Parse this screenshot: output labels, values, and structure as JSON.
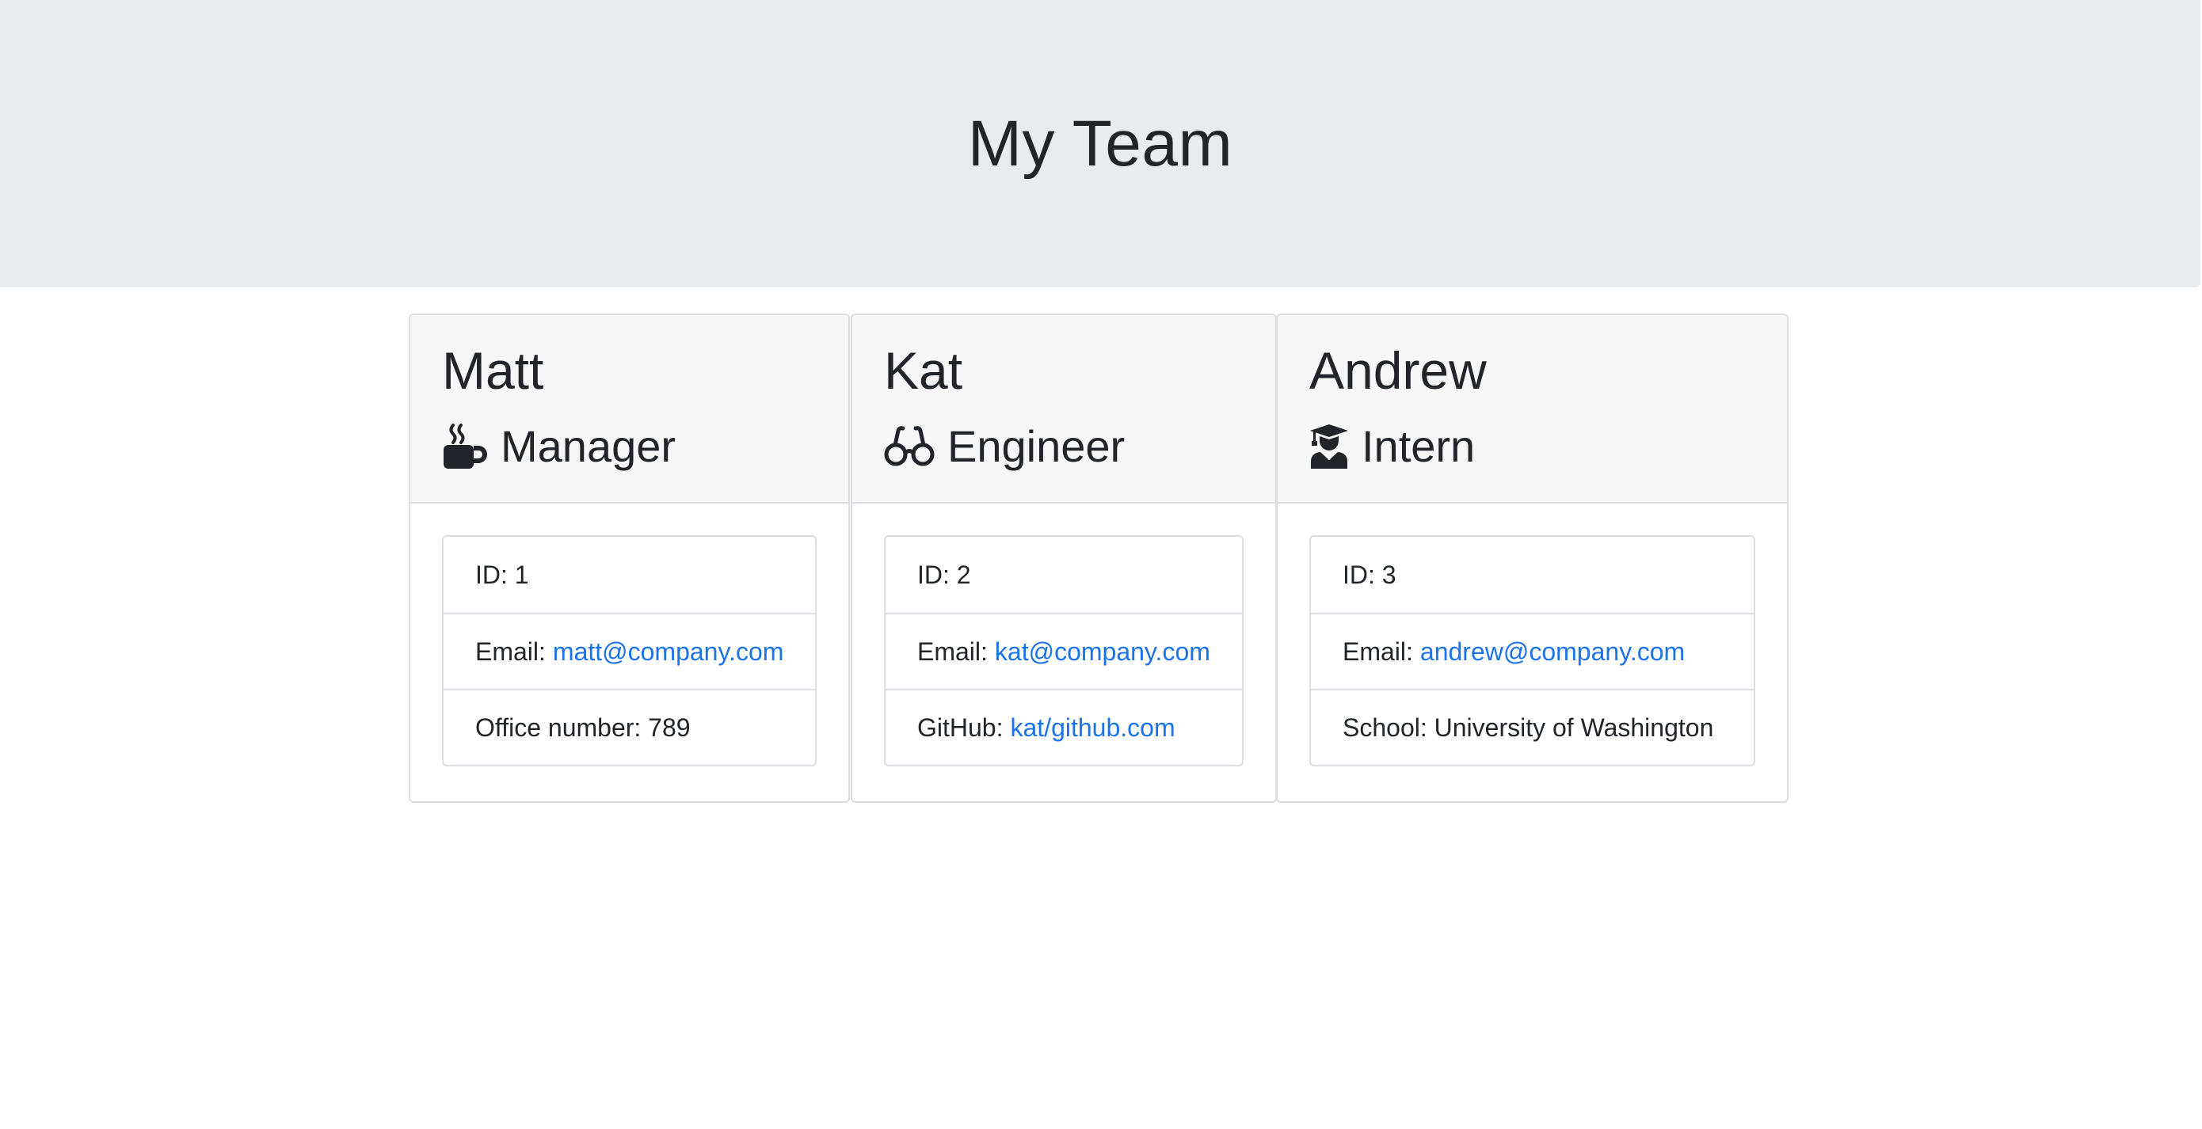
{
  "header": {
    "title": "My Team"
  },
  "employees": [
    {
      "name": "Matt",
      "role": "Manager",
      "role_icon": "mug-hot-icon",
      "id_label": "ID:",
      "id": "1",
      "email_label": "Email:",
      "email": "matt@company.com",
      "extra_label": "Office number:",
      "extra_value": "789"
    },
    {
      "name": "Kat",
      "role": "Engineer",
      "role_icon": "glasses-icon",
      "id_label": "ID:",
      "id": "2",
      "email_label": "Email:",
      "email": "kat@company.com",
      "extra_label": "GitHub:",
      "extra_value": "kat/github.com"
    },
    {
      "name": "Andrew",
      "role": "Intern",
      "role_icon": "user-graduate-icon",
      "id_label": "ID:",
      "id": "3",
      "email_label": "Email:",
      "email": "andrew@company.com",
      "extra_label": "School:",
      "extra_value": "University of Washington"
    }
  ],
  "colors": {
    "jumbotron_bg": "#e9ecef",
    "card_header_bg": "#f6f6f6",
    "link": "#1a73e8",
    "text": "#212529",
    "border": "#dadde1"
  }
}
